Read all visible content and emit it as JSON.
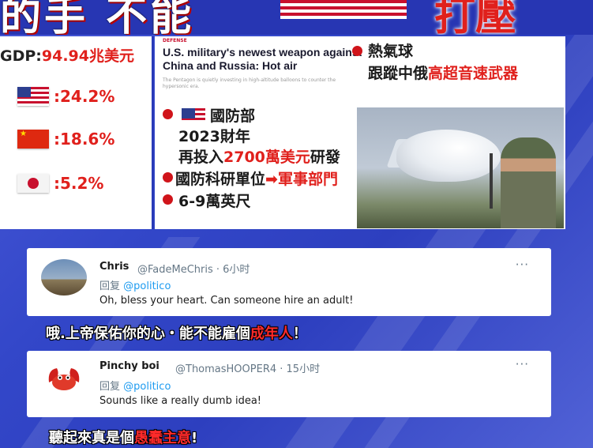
{
  "banner": {
    "title_glyphs": "的手 不能",
    "title_red": "打壓"
  },
  "gdp_panel": {
    "title_prefix": "GDP:",
    "title_value": "94.94兆美元",
    "rows": [
      {
        "flag": "us-flag-icon",
        "value": ":24.2%"
      },
      {
        "flag": "china-flag-icon",
        "value": ":18.6%"
      },
      {
        "flag": "japan-flag-icon",
        "value": ":5.2%"
      }
    ]
  },
  "news": {
    "label": "DEFENSE",
    "headline": "U.S. military's newest weapon against China and Russia: Hot air",
    "subhead": "The Pentagon is quietly investing in high-altitude balloons to counter the hypersonic era.",
    "note_line1": "熱氣球",
    "note_line2_prefix": "跟蹤中俄",
    "note_line2_red": "高超音速武器",
    "dept": "國防部",
    "year": "2023財年",
    "invest_prefix": "再投入",
    "invest_red": "2700萬美元",
    "invest_suffix": "研發",
    "unit_prefix": "國防科研單位",
    "unit_arrow": "➡",
    "unit_red": "軍事部門",
    "altitude": "6-9萬英尺"
  },
  "tweets": [
    {
      "name": "Chris",
      "handle": "@FadeMeChris · 6小时",
      "reply_prefix": "回复",
      "reply_to": "@politico",
      "body": "Oh, bless your heart. Can someone hire an adult!",
      "more": "···"
    },
    {
      "name": "Pinchy boi",
      "handle": "@ThomasHOOPER4 · 15小时",
      "reply_prefix": "回复",
      "reply_to": "@politico",
      "body": "Sounds like a really dumb idea!",
      "more": "···"
    }
  ],
  "captions": [
    {
      "text": "哦.上帝保佑你的心・能不能雇個",
      "highlight": "成年人",
      "suffix": "！"
    },
    {
      "text": "聽起來真是個",
      "highlight": "愚蠢主意",
      "suffix": "!"
    }
  ]
}
